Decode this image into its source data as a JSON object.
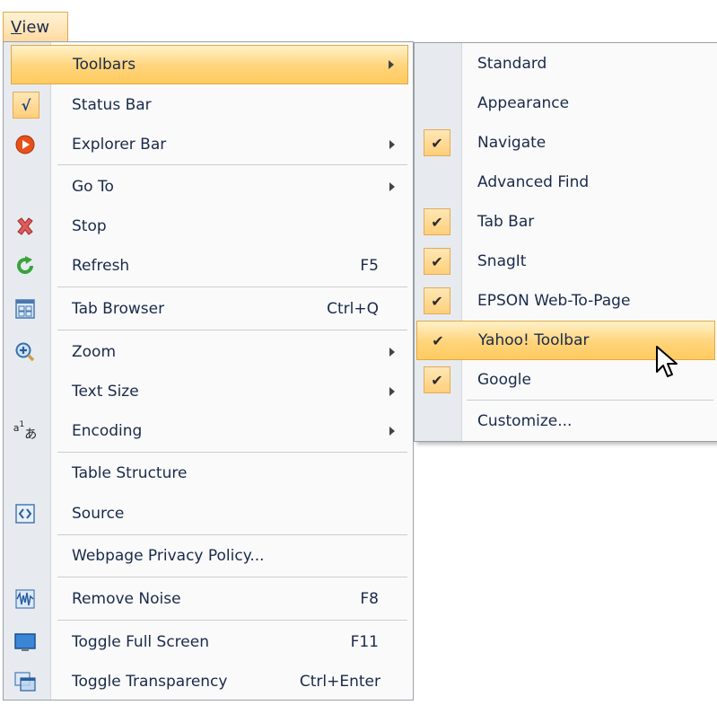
{
  "menubar": {
    "view_prefix": "V",
    "view_rest": "iew"
  },
  "main_menu": {
    "toolbars": "Toolbars",
    "status_bar": "Status Bar",
    "explorer_bar": "Explorer Bar",
    "go_to": "Go To",
    "stop": "Stop",
    "refresh": "Refresh",
    "refresh_shortcut": "F5",
    "tab_browser": "Tab Browser",
    "tab_browser_shortcut": "Ctrl+Q",
    "zoom": "Zoom",
    "text_size": "Text Size",
    "encoding": "Encoding",
    "table_structure": "Table Structure",
    "source": "Source",
    "privacy_policy": "Webpage Privacy Policy...",
    "remove_noise": "Remove Noise",
    "remove_noise_shortcut": "F8",
    "full_screen": "Toggle Full Screen",
    "full_screen_shortcut": "F11",
    "transparency": "Toggle Transparency",
    "transparency_shortcut": "Ctrl+Enter"
  },
  "toolbars_submenu": {
    "items": [
      {
        "label": "Standard",
        "checked": false
      },
      {
        "label": "Appearance",
        "checked": false
      },
      {
        "label": "Navigate",
        "checked": true
      },
      {
        "label": "Advanced Find",
        "checked": false
      },
      {
        "label": "Tab Bar",
        "checked": true
      },
      {
        "label": "SnagIt",
        "checked": true
      },
      {
        "label": "EPSON Web-To-Page",
        "checked": true
      },
      {
        "label": "Yahoo! Toolbar",
        "checked": true
      },
      {
        "label": "Google",
        "checked": true
      },
      {
        "label": "Customize...",
        "checked": false
      }
    ],
    "check_glyph": "✔"
  },
  "colors": {
    "highlight": "#ffd47a",
    "gutter": "#e7ebef",
    "text": "#1a2a4a"
  }
}
